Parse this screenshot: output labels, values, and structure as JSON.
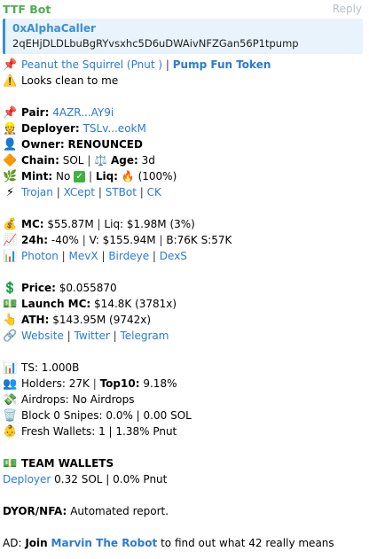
{
  "header": {
    "sender": "TTF Bot",
    "reply": "Reply"
  },
  "quote": {
    "title": "0xAlphaCaller",
    "text": "2qEHjDLDLbuBgRYvsxhc5D6uDWAivNFZGan56P1tpump"
  },
  "token": {
    "name": "Peanut the Squirrel",
    "symbol": "(Pnut )",
    "sep": "|",
    "platform": "Pump Fun Token"
  },
  "warning": {
    "text": "Looks clean to me"
  },
  "pair": {
    "label": "Pair:",
    "value": "4AZR...AY9i"
  },
  "deployer": {
    "label": "Deployer:",
    "value": "TSLv...eokM"
  },
  "owner": {
    "label": "Owner:",
    "value": "RENOUNCED"
  },
  "chain": {
    "label": "Chain:",
    "value": "SOL",
    "sep": "|",
    "age_label": "Age:",
    "age_value": "3d"
  },
  "mint": {
    "label": "Mint:",
    "value": "No",
    "check": "✓",
    "sep": "|",
    "liq_label": "Liq:",
    "liq_value": "(100%)"
  },
  "bots": {
    "items": [
      "Trojan",
      "XCept",
      "STBot",
      "CK"
    ],
    "sep": "|"
  },
  "market": {
    "mc_label": "MC:",
    "mc_value": "$55.87M",
    "sep": "|",
    "liq_text": "Liq: $1.98M (3%)",
    "h24_label": "24h:",
    "h24_value": "-40%",
    "vol_text": "V: $155.94M",
    "bs_label": "B:76K S:57K"
  },
  "charts": {
    "items": [
      "Photon",
      "MevX",
      "Birdeye",
      "DexS"
    ],
    "sep": "|"
  },
  "price": {
    "label": "Price:",
    "value": "$0.055870"
  },
  "launch": {
    "label": "Launch MC:",
    "value": "$14.8K (3781x)"
  },
  "ath": {
    "label": "ATH:",
    "value": "$143.95M (9742x)"
  },
  "links": {
    "items": [
      "Website",
      "Twitter",
      "Telegram"
    ],
    "sep": "|"
  },
  "stats": {
    "ts": "TS: 1.000B",
    "holders": "Holders: 27K",
    "sep": "|",
    "top10_label": "Top10:",
    "top10_value": "9.18%",
    "airdrops": "Airdrops: No Airdrops",
    "snipes": "Block 0 Snipes: 0.0% | 0.00 SOL",
    "fresh": "Fresh Wallets: 1 | 1.38% Pnut"
  },
  "team": {
    "title": "TEAM WALLETS",
    "deployer_link": "Deployer",
    "deployer_value": "0.32 SOL | 0.0% Pnut"
  },
  "dyor": {
    "label": "DYOR/NFA:",
    "text": "Automated report."
  },
  "ad": {
    "prefix": "AD:",
    "join": "Join",
    "link": "Marvin The Robot",
    "suffix": "to find out what 42 really means"
  },
  "icons": {
    "pin": "pushpin-icon",
    "warning": "warning-icon",
    "pair": "pushpin-icon",
    "deployer": "builder-icon",
    "owner": "person-icon",
    "chain": "diamond-icon",
    "age": "scales-icon",
    "mint": "herb-icon",
    "liq": "fire-icon",
    "bots": "lightning-icon",
    "mc": "moneybag-icon",
    "h24": "chart-up-icon",
    "charts": "bar-chart-icon",
    "price": "dollar-icon",
    "launch": "banknote-icon",
    "ath": "pointing-up-icon",
    "links": "link-icon",
    "ts": "bar-chart-icon",
    "holders": "people-icon",
    "airdrops": "money-wings-icon",
    "snipes": "trash-icon",
    "fresh": "baby-icon",
    "team": "banknote-icon"
  },
  "colors": {
    "sender": "#4fae4e",
    "link": "#2a7ad6",
    "quote_bar": "#3a8fd6",
    "quote_bg": "#e8f3fb"
  }
}
